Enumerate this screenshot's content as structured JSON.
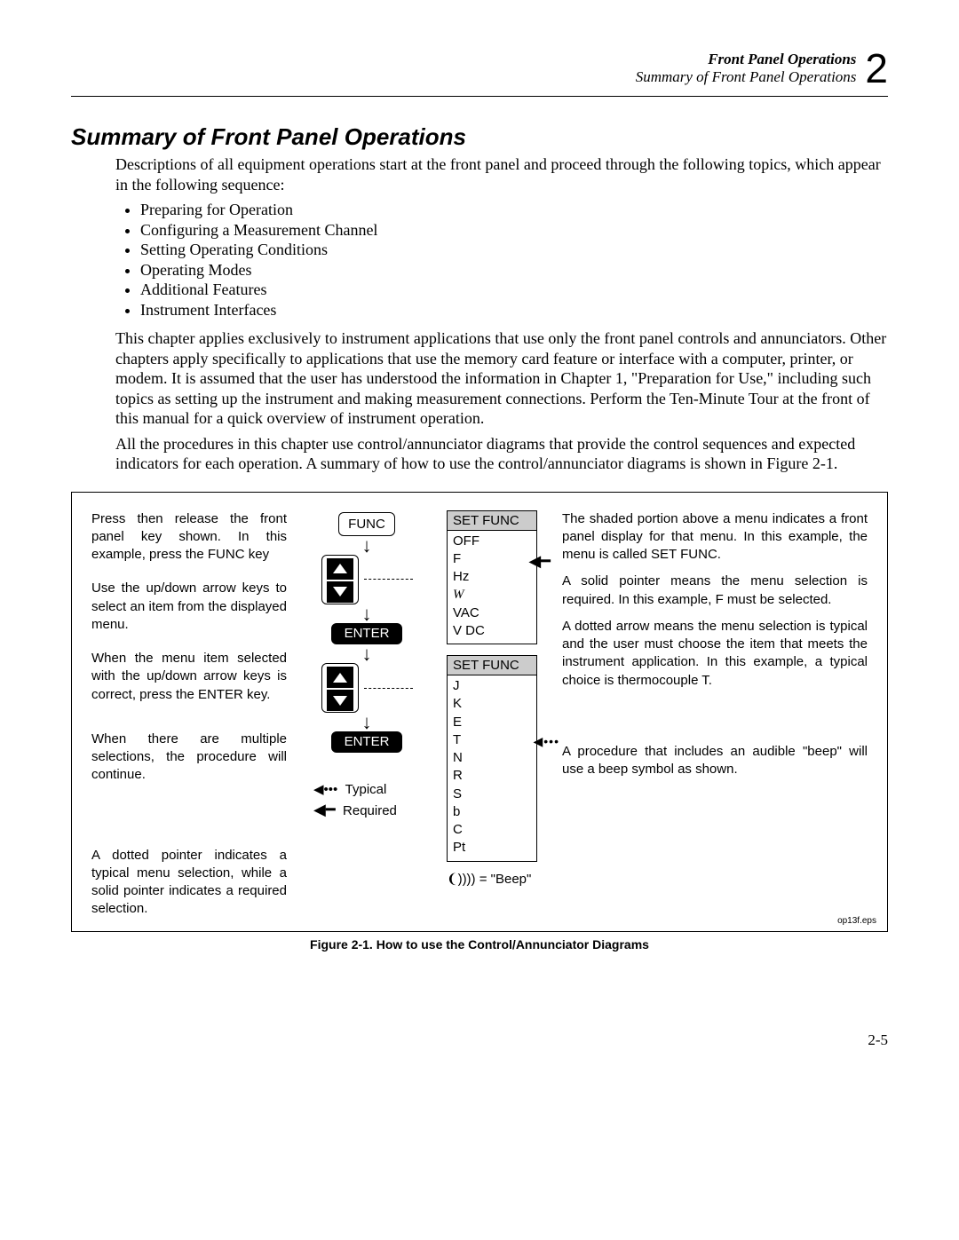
{
  "header": {
    "line1": "Front Panel Operations",
    "line2": "Summary of Front Panel Operations",
    "chapter_num": "2"
  },
  "section_title": "Summary of Front Panel Operations",
  "intro_para": "Descriptions of all equipment operations start at the front panel and proceed through the following topics, which appear in the following sequence:",
  "topics": [
    "Preparing for Operation",
    "Configuring a Measurement Channel",
    "Setting Operating Conditions",
    "Operating Modes",
    "Additional Features",
    "Instrument Interfaces"
  ],
  "para2": "This chapter applies exclusively to instrument applications that use only the front panel controls and annunciators. Other chapters apply specifically to applications that use the memory card feature or interface with a computer, printer, or modem. It is assumed that the user has understood the information in Chapter 1, \"Preparation for Use,\" including such topics as setting up the instrument and making measurement connections. Perform the Ten-Minute Tour at the front of this manual for a quick overview of instrument operation.",
  "para3": "All the procedures in this chapter use control/annunciator diagrams that provide the control sequences and expected indicators for each operation. A summary of how to use the control/annunciator diagrams is shown in Figure 2-1.",
  "figure": {
    "left": {
      "p1": "Press then release the front panel key shown. In this example, press the FUNC key",
      "p2": "Use the up/down arrow keys to select an item from the displayed menu.",
      "p3": "When the menu item selected with the up/down arrow keys is correct, press the ENTER key.",
      "p4": "When there are multiple selections, the procedure will continue.",
      "p5": "A dotted pointer indicates a typical menu selection, while a solid pointer indicates a required selection."
    },
    "keys": {
      "func": "FUNC",
      "enter": "ENTER"
    },
    "menu1": {
      "title": "SET FUNC",
      "items": [
        "OFF",
        "F",
        "Hz",
        "W",
        "VAC",
        "V DC"
      ]
    },
    "menu2": {
      "title": "SET FUNC",
      "items": [
        "J",
        "K",
        "E",
        "T",
        "N",
        "R",
        "S",
        "b",
        "C",
        "Pt"
      ]
    },
    "right": {
      "p1": "The shaded portion above a menu indicates a front panel display for that menu. In this example, the menu is called SET FUNC.",
      "p2": "A solid pointer means the menu selection is required. In this example, F must be selected.",
      "p3": "A dotted arrow means the menu selection is typical and the user must choose the item that meets the instrument application. In this example, a typical choice is thermocouple T.",
      "p4": "A procedure that includes an audible \"beep\" will use a beep symbol as shown."
    },
    "legend": {
      "typical": "Typical",
      "required": "Required",
      "beep": "= \"Beep\""
    },
    "eps": "op13f.eps"
  },
  "figure_caption": "Figure 2-1. How to use the Control/Annunciator Diagrams",
  "page_num": "2-5"
}
